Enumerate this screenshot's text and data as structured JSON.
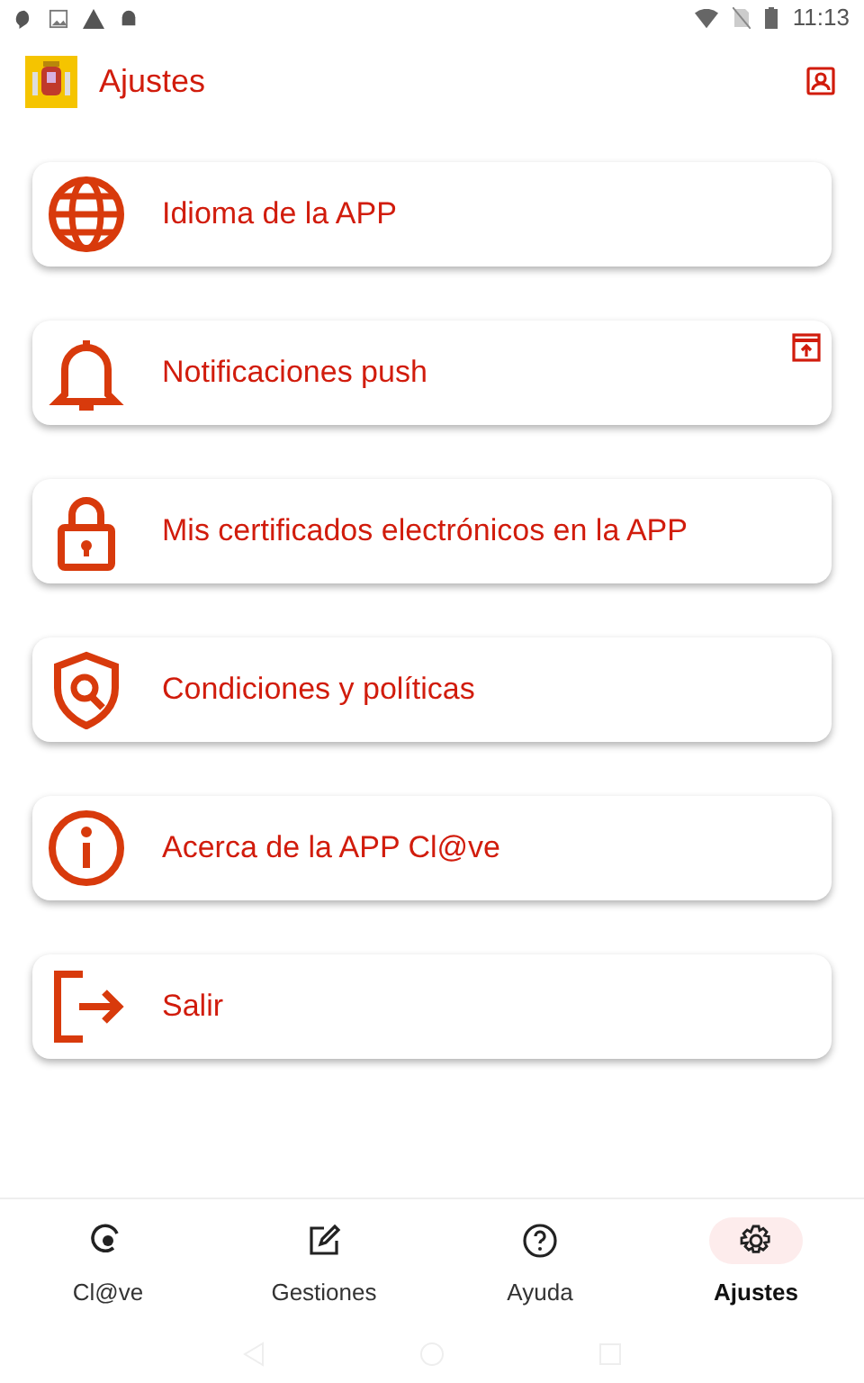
{
  "status_bar": {
    "time": "11:13"
  },
  "header": {
    "title": "Ajustes"
  },
  "items": [
    {
      "kind": "globe",
      "label": "Idioma de la APP",
      "external": false
    },
    {
      "kind": "bell",
      "label": "Notificaciones push",
      "external": true
    },
    {
      "kind": "lock",
      "label": "Mis certificados electrónicos en la APP",
      "external": false
    },
    {
      "kind": "shield",
      "label": "Condiciones y políticas",
      "external": false
    },
    {
      "kind": "info",
      "label": "Acerca de la APP Cl@ve",
      "external": false
    },
    {
      "kind": "exit",
      "label": "Salir",
      "external": false
    }
  ],
  "bottom_nav": [
    {
      "kind": "clave",
      "label": "Cl@ve",
      "selected": false
    },
    {
      "kind": "edit",
      "label": "Gestiones",
      "selected": false
    },
    {
      "kind": "help",
      "label": "Ayuda",
      "selected": false
    },
    {
      "kind": "gear",
      "label": "Ajustes",
      "selected": true
    }
  ]
}
